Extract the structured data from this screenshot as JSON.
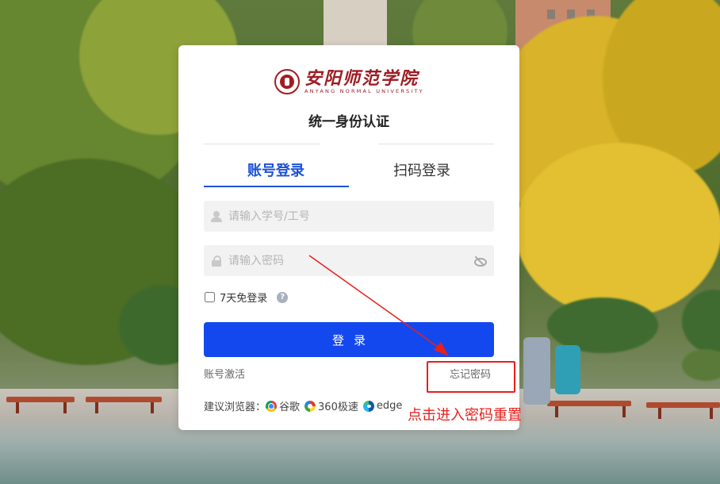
{
  "logo": {
    "name_cn": "安阳师范学院",
    "name_en": "ANYANG NORMAL UNIVERSITY"
  },
  "heading": "统一身份认证",
  "tabs": [
    {
      "label": "账号登录",
      "active": true
    },
    {
      "label": "扫码登录",
      "active": false
    }
  ],
  "form": {
    "username_placeholder": "请输入学号/工号",
    "username_value": "",
    "password_placeholder": "请输入密码",
    "password_value": "",
    "remember_label": "7天免登录",
    "remember_checked": false,
    "help_glyph": "?",
    "login_button": "登录"
  },
  "links": {
    "activate": "账号激活",
    "forgot": "忘记密码"
  },
  "browsers": {
    "label": "建议浏览器：",
    "items": [
      {
        "name": "谷歌",
        "icon": "chrome-icon"
      },
      {
        "name": "360极速",
        "icon": "360-browser-icon"
      },
      {
        "name": "edge",
        "icon": "edge-icon"
      }
    ]
  },
  "annotation": {
    "text": "点击进入密码重置",
    "color": "#e8201b"
  },
  "colors": {
    "accent": "#1c52d9",
    "button": "#1448ef",
    "brand": "#9e1c22"
  }
}
